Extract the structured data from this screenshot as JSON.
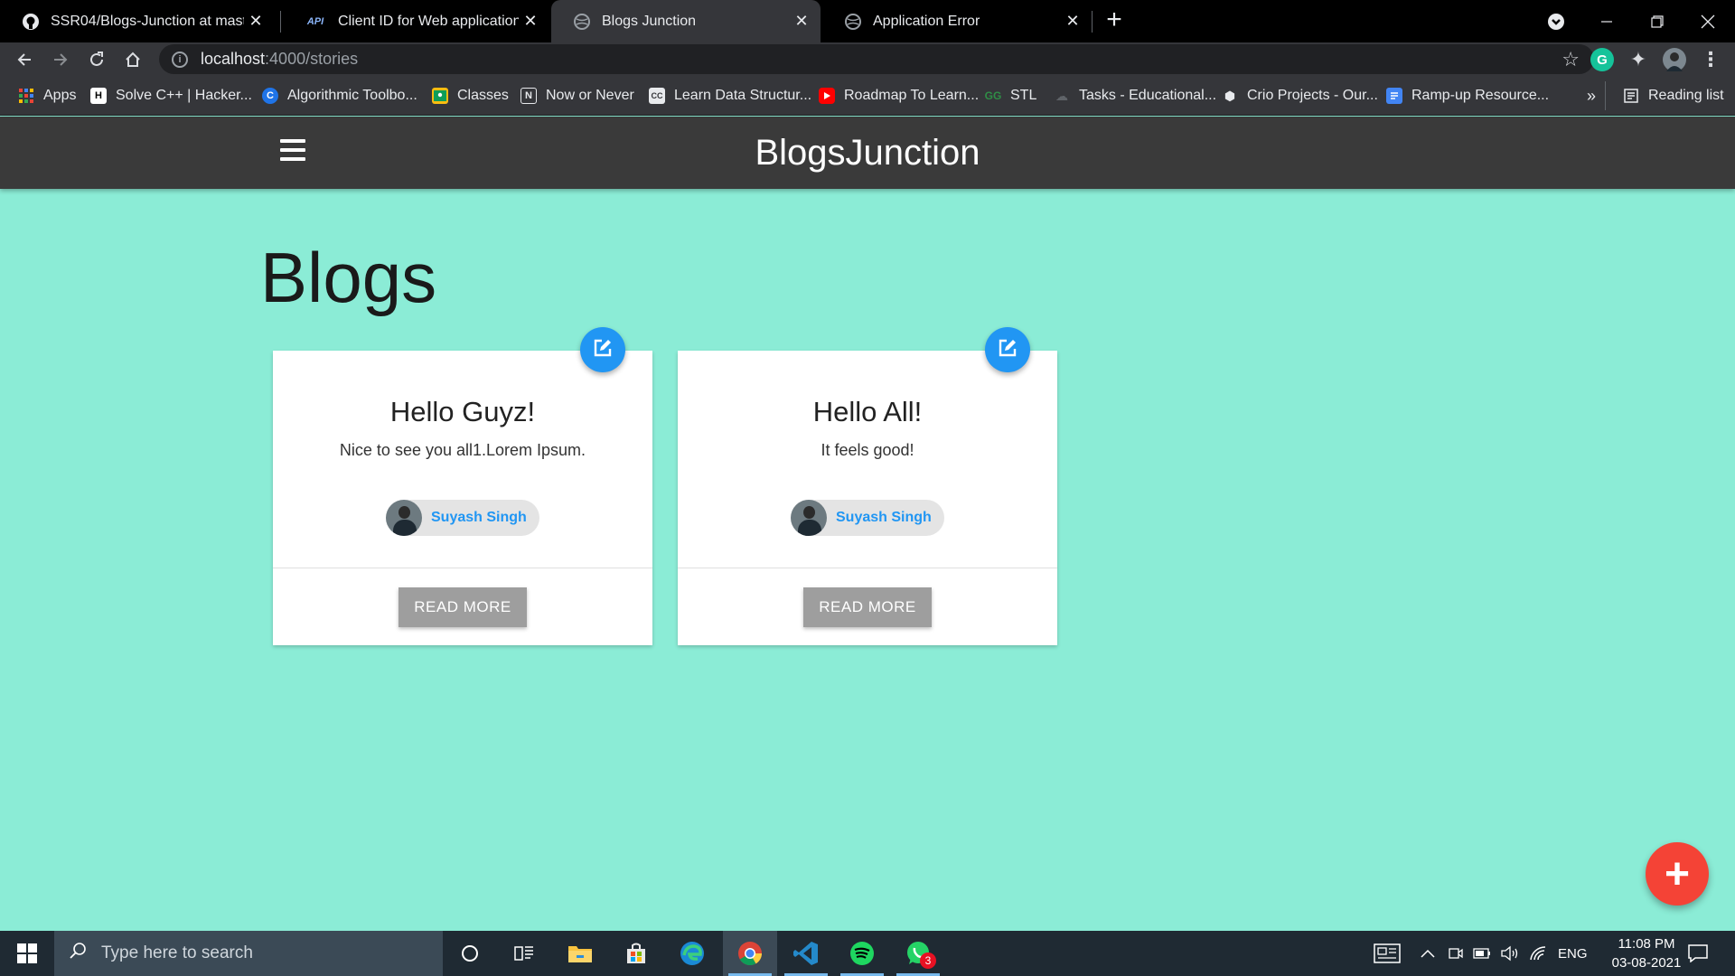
{
  "browser": {
    "tabs": [
      {
        "title": "SSR04/Blogs-Junction at master",
        "icon": "github-icon"
      },
      {
        "title": "Client ID for Web application – A",
        "icon": "api-icon",
        "badge": "API"
      },
      {
        "title": "Blogs Junction",
        "icon": "globe-icon"
      },
      {
        "title": "Application Error",
        "icon": "globe-icon"
      }
    ],
    "new_tab": "+",
    "url_host": "localhost",
    "url_path": ":4000/stories",
    "bookmarks": [
      {
        "label": "Apps",
        "icon": "apps-grid-icon"
      },
      {
        "label": "Solve C++ | Hacker...",
        "icon": "hackerrank-icon",
        "glyph": "H"
      },
      {
        "label": "Algorithmic Toolbo...",
        "icon": "coursera-icon",
        "glyph": "C"
      },
      {
        "label": "Classes",
        "icon": "classroom-icon"
      },
      {
        "label": "Now or Never",
        "icon": "notion-icon"
      },
      {
        "label": "Learn Data Structur...",
        "icon": "cc-icon",
        "glyph": "CC"
      },
      {
        "label": "Roadmap To Learn...",
        "icon": "youtube-icon"
      },
      {
        "label": "STL",
        "icon": "gfg-icon",
        "glyph": "GG"
      },
      {
        "label": "Tasks - Educational...",
        "icon": "cloud-icon"
      },
      {
        "label": "Crio Projects - Our...",
        "icon": "crio-icon"
      },
      {
        "label": "Ramp-up Resource...",
        "icon": "docs-icon"
      }
    ],
    "more_bookmarks": "»",
    "reading_list": "Reading list",
    "extension_grammarly": "G"
  },
  "app": {
    "brand": "BlogsJunction",
    "page_title": "Blogs",
    "cards": [
      {
        "title": "Hello Guyz!",
        "text": "Nice to see you all1.Lorem Ipsum.",
        "author": "Suyash Singh",
        "button": "READ MORE"
      },
      {
        "title": "Hello All!",
        "text": "It feels good!",
        "author": "Suyash Singh",
        "button": "READ MORE"
      }
    ],
    "add_button": "+",
    "colors": {
      "background": "#8becd6",
      "header": "#3a3a3a",
      "edit_fab": "#2196f3",
      "add_fab": "#f44336",
      "author": "#2196f3"
    }
  },
  "taskbar": {
    "search_placeholder": "Type here to search",
    "language": "ENG",
    "time": "11:08 PM",
    "date": "03-08-2021",
    "whatsapp_badge": "3"
  }
}
